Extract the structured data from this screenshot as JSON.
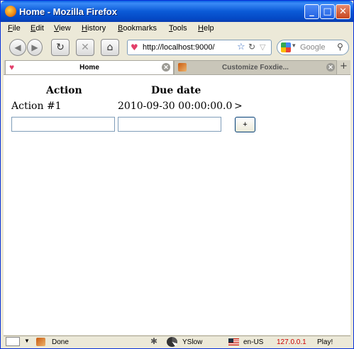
{
  "window": {
    "title": "Home - Mozilla Firefox"
  },
  "menu": [
    {
      "label": "File"
    },
    {
      "label": "Edit"
    },
    {
      "label": "View"
    },
    {
      "label": "History"
    },
    {
      "label": "Bookmarks"
    },
    {
      "label": "Tools"
    },
    {
      "label": "Help"
    }
  ],
  "nav": {
    "url": "http://localhost:9000/",
    "search_placeholder": "Google"
  },
  "tabs": [
    {
      "label": "Home",
      "active": true
    },
    {
      "label": "Customize Foxdie...",
      "active": false
    }
  ],
  "page": {
    "headers": {
      "action": "Action",
      "due_date": "Due date"
    },
    "rows": [
      {
        "action": "Action #1",
        "due": "2010-09-30 00:00:00.0",
        "arrow": ">"
      }
    ],
    "form": {
      "action_value": "",
      "due_value": "",
      "add_label": "+"
    }
  },
  "status": {
    "text": "Done",
    "yslow": "YSlow",
    "locale": "en-US",
    "ip": "127.0.0.1",
    "ip_color": "#cc0000",
    "play": "Play!"
  },
  "colors": {
    "titlebar": "#0a5fe2",
    "chrome": "#ece9d8"
  }
}
